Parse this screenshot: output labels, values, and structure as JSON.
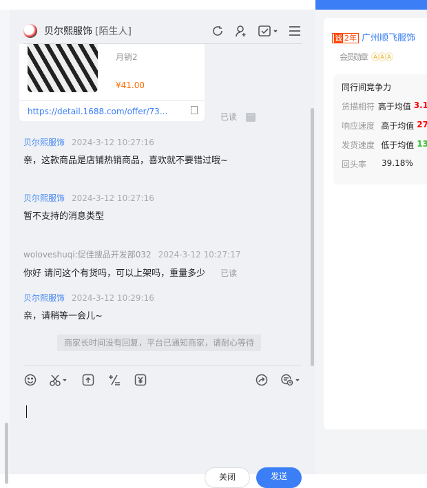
{
  "header": {
    "name": "贝尔熙服饰",
    "tag": "[陌生人]"
  },
  "product": {
    "sales": "月销2",
    "price": "¥41.00",
    "link": "https://detail.1688.com/offer/73...",
    "read": "已读",
    "more": "···"
  },
  "messages": [
    {
      "user": "贝尔熙服饰",
      "time": "2024-3-12 10:27:16",
      "text": "亲，这款商品是店铺热销商品，喜欢就不要错过哦~"
    },
    {
      "user": "贝尔熙服饰",
      "time": "2024-3-12 10:27:16",
      "text": "暂不支持的消息类型"
    },
    {
      "user": "woloveshuqi:促佳搜品开发部032",
      "time": "2024-3-12 10:27:17",
      "text": "你好 请问这个有货吗，可以上架吗，重量多少",
      "read": "已读"
    },
    {
      "user": "贝尔熙服饰",
      "time": "2024-3-12 10:29:16",
      "text": "亲，请稍等一会儿~"
    }
  ],
  "notice": "商家长时间没有回复，平台已通知商家，请耐心等待",
  "buttons": {
    "close": "关闭",
    "send": "发送"
  },
  "shop": {
    "years_icon": "诚",
    "years": "2年",
    "name": "广州顺飞服饰",
    "medal_label": "会员勋章",
    "medals": "ⒶⒶⒶ",
    "comp_title": "同行间竞争力",
    "rows": [
      {
        "k": "货描相符",
        "v": "高于均值",
        "n": "3.1"
      },
      {
        "k": "响应速度",
        "v": "高于均值",
        "n": "27"
      },
      {
        "k": "发货速度",
        "v": "低于均值",
        "n": "13"
      },
      {
        "k": "回头率",
        "v": "39.18%"
      }
    ]
  }
}
